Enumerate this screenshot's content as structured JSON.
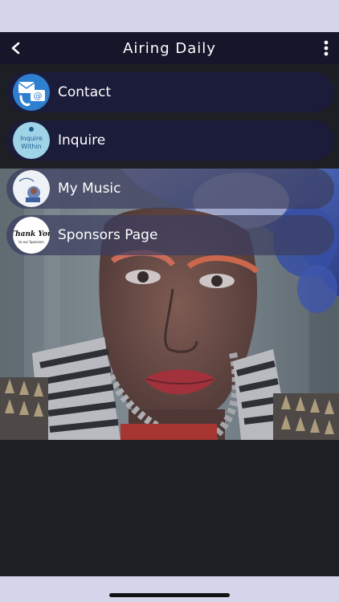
{
  "header": {
    "title": "Airing Daily",
    "back_icon": "chevron-left-icon",
    "more_icon": "more-vertical-icon"
  },
  "menu": {
    "items": [
      {
        "label": "Contact",
        "icon": "contact-envelope-phone-icon"
      },
      {
        "label": "Inquire",
        "icon": "inquire-within-icon",
        "icon_text_1": "Inquire",
        "icon_text_2": "Within"
      },
      {
        "label": "My Music",
        "icon": "music-artist-icon"
      },
      {
        "label": "Sponsors Page",
        "icon": "thank-you-icon",
        "icon_text_1": "Thank You",
        "icon_text_2": "to our Sponsors"
      }
    ]
  },
  "colors": {
    "navbar": "#15162a",
    "menu_solid": "#1a1c3a",
    "app_background": "#1e1f24",
    "system_bar": "#d4d5ea"
  }
}
